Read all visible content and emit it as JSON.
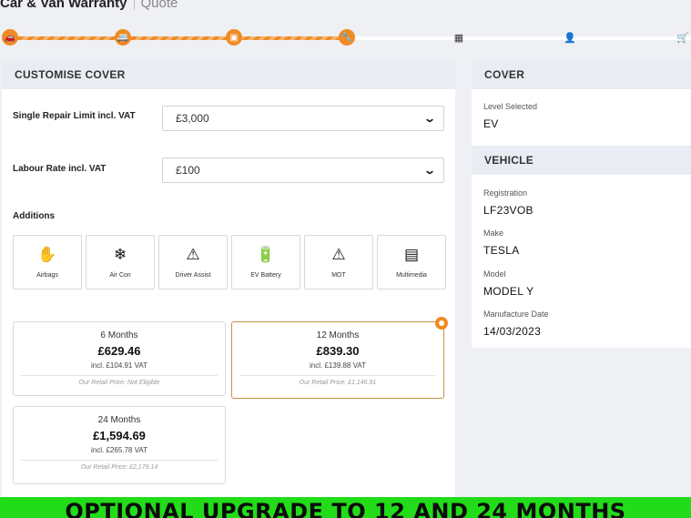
{
  "header": {
    "title": "Car & Van Warranty",
    "subtitle": "Quote"
  },
  "progress": {
    "steps": [
      {
        "icon": "car-icon",
        "glyph": "🚗",
        "status": "done"
      },
      {
        "icon": "van-icon",
        "glyph": "🚐",
        "status": "done"
      },
      {
        "icon": "id-card-icon",
        "glyph": "▣",
        "status": "done"
      },
      {
        "icon": "wrench-icon",
        "glyph": "🔧",
        "status": "current"
      },
      {
        "icon": "calendar-icon",
        "glyph": "▦",
        "status": "todo"
      },
      {
        "icon": "user-icon",
        "glyph": "👤",
        "status": "todo"
      },
      {
        "icon": "cart-icon",
        "glyph": "🛒",
        "status": "todo"
      }
    ],
    "accent": "#f08a24"
  },
  "customise": {
    "heading": "CUSTOMISE COVER",
    "repair_limit": {
      "label": "Single Repair Limit incl. VAT",
      "value": "£3,000"
    },
    "labour_rate": {
      "label": "Labour Rate incl. VAT",
      "value": "£100"
    },
    "additions_label": "Additions",
    "additions": [
      {
        "label": "Airbags",
        "icon": "airbag-icon",
        "glyph": "✋"
      },
      {
        "label": "Air Con",
        "icon": "snowflake-icon",
        "glyph": "❄"
      },
      {
        "label": "Driver Assist",
        "icon": "driver-assist-icon",
        "glyph": "⚠"
      },
      {
        "label": "EV Battery",
        "icon": "battery-icon",
        "glyph": "🔋"
      },
      {
        "label": "MOT",
        "icon": "mot-icon",
        "glyph": "⚠"
      },
      {
        "label": "Multimedia",
        "icon": "multimedia-icon",
        "glyph": "▤"
      }
    ],
    "plans": [
      {
        "term": "6 Months",
        "price": "£629.46",
        "vat": "incl. £104.91 VAT",
        "retail": "Our Retail Price: Not Eligible",
        "selected": false
      },
      {
        "term": "12 Months",
        "price": "£839.30",
        "vat": "incl. £139.88 VAT",
        "retail": "Our Retail Price: £1,146.91",
        "selected": true
      },
      {
        "term": "24 Months",
        "price": "£1,594.69",
        "vat": "incl. £265.78 VAT",
        "retail": "Our Retail Price: £2,179.14",
        "selected": false
      }
    ]
  },
  "cover": {
    "heading": "COVER",
    "level_label": "Level Selected",
    "level_value": "EV"
  },
  "vehicle": {
    "heading": "VEHICLE",
    "registration_label": "Registration",
    "registration": "LF23VOB",
    "make_label": "Make",
    "make": "TESLA",
    "model_label": "Model",
    "model": "MODEL Y",
    "date_label": "Manufacture Date",
    "date": "14/03/2023"
  },
  "banner": {
    "text": "OPTIONAL UPGRADE TO 12 AND 24 MONTHS",
    "color": "#22dc1a"
  }
}
